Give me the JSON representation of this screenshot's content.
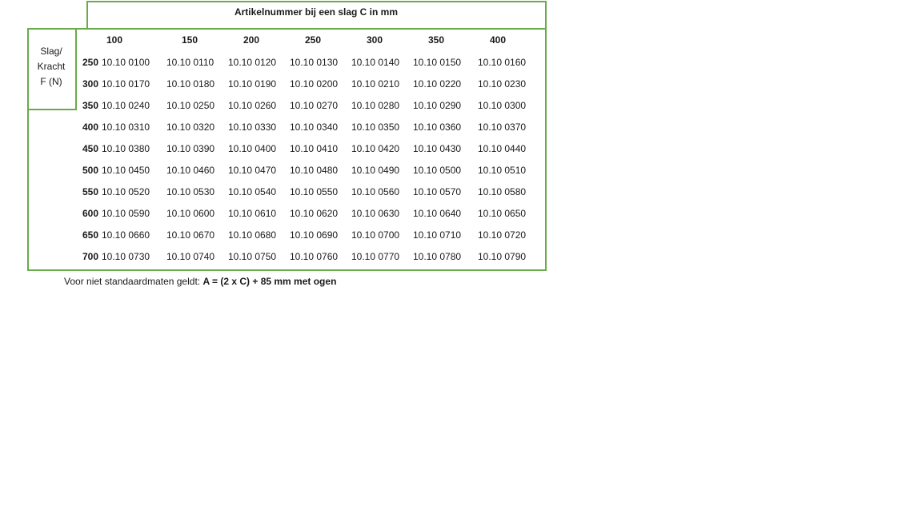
{
  "table": {
    "title": "Artikelnummer bij een slag C in mm",
    "row_header": [
      "Slag/",
      "Kracht",
      "F (N)"
    ],
    "strokes": [
      "100",
      "150",
      "200",
      "250",
      "300",
      "350",
      "400"
    ],
    "rows": [
      {
        "force": "250",
        "codes": [
          "10.10 0100",
          "10.10 0110",
          "10.10 0120",
          "10.10 0130",
          "10.10 0140",
          "10.10 0150",
          "10.10 0160"
        ]
      },
      {
        "force": "300",
        "codes": [
          "10.10 0170",
          "10.10 0180",
          "10.10 0190",
          "10.10 0200",
          "10.10 0210",
          "10.10 0220",
          "10.10 0230"
        ]
      },
      {
        "force": "350",
        "codes": [
          "10.10 0240",
          "10.10 0250",
          "10.10 0260",
          "10.10 0270",
          "10.10 0280",
          "10.10 0290",
          "10.10 0300"
        ]
      },
      {
        "force": "400",
        "codes": [
          "10.10 0310",
          "10.10 0320",
          "10.10 0330",
          "10.10 0340",
          "10.10 0350",
          "10.10 0360",
          "10.10 0370"
        ]
      },
      {
        "force": "450",
        "codes": [
          "10.10 0380",
          "10.10 0390",
          "10.10 0400",
          "10.10 0410",
          "10.10 0420",
          "10.10 0430",
          "10.10 0440"
        ]
      },
      {
        "force": "500",
        "codes": [
          "10.10 0450",
          "10.10 0460",
          "10.10 0470",
          "10.10 0480",
          "10.10 0490",
          "10.10 0500",
          "10.10 0510"
        ]
      },
      {
        "force": "550",
        "codes": [
          "10.10 0520",
          "10.10 0530",
          "10.10 0540",
          "10.10 0550",
          "10.10 0560",
          "10.10 0570",
          "10.10 0580"
        ]
      },
      {
        "force": "600",
        "codes": [
          "10.10 0590",
          "10.10 0600",
          "10.10 0610",
          "10.10 0620",
          "10.10 0630",
          "10.10 0640",
          "10.10 0650"
        ]
      },
      {
        "force": "650",
        "codes": [
          "10.10 0660",
          "10.10 0670",
          "10.10 0680",
          "10.10 0690",
          "10.10 0700",
          "10.10 0710",
          "10.10 0720"
        ]
      },
      {
        "force": "700",
        "codes": [
          "10.10 0730",
          "10.10 0740",
          "10.10 0750",
          "10.10 0760",
          "10.10 0770",
          "10.10 0780",
          "10.10 0790"
        ]
      }
    ]
  },
  "note": {
    "prefix": "Voor niet standaardmaten geldt: ",
    "formula": "A = (2 x C) + 85 mm met ogen"
  },
  "colors": {
    "border": "#6aaa4a"
  }
}
